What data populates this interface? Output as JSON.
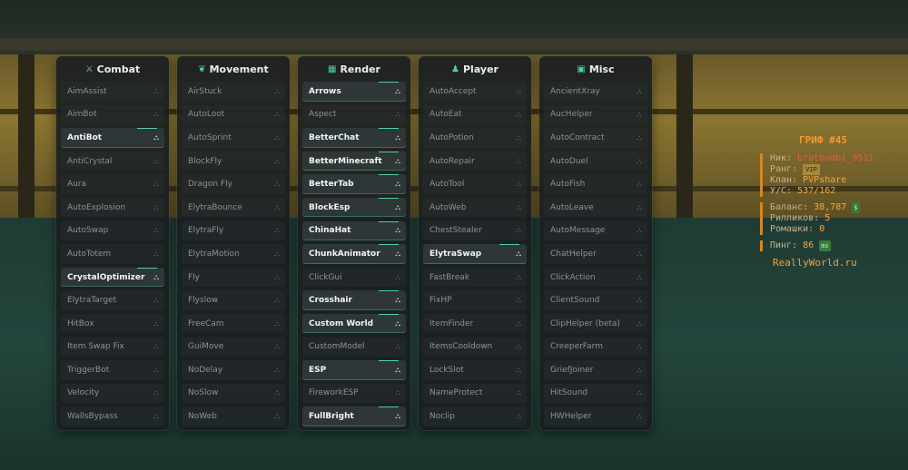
{
  "panels": [
    {
      "id": "combat",
      "icon": "crossed-swords-icon",
      "icon_char": "⚔",
      "title": "Combat",
      "modules": [
        {
          "label": "AimAssist",
          "on": false
        },
        {
          "label": "AimBot",
          "on": false
        },
        {
          "label": "AntiBot",
          "on": true
        },
        {
          "label": "AntiCrystal",
          "on": false
        },
        {
          "label": "Aura",
          "on": false
        },
        {
          "label": "AutoExplosion",
          "on": false
        },
        {
          "label": "AutoSwap",
          "on": false
        },
        {
          "label": "AutoTotem",
          "on": false
        },
        {
          "label": "CrystalOptimizer",
          "on": true
        },
        {
          "label": "ElytraTarget",
          "on": false
        },
        {
          "label": "HitBox",
          "on": false
        },
        {
          "label": "Item Swap Fix",
          "on": false
        },
        {
          "label": "TriggerBot",
          "on": false
        },
        {
          "label": "Velocity",
          "on": false
        },
        {
          "label": "WallsBypass",
          "on": false
        }
      ]
    },
    {
      "id": "movement",
      "icon": "leaf-icon",
      "icon_char": "❦",
      "title": "Movement",
      "modules": [
        {
          "label": "AirStuck",
          "on": false
        },
        {
          "label": "AutoLoot",
          "on": false
        },
        {
          "label": "AutoSprint",
          "on": false
        },
        {
          "label": "BlockFly",
          "on": false
        },
        {
          "label": "Dragon Fly",
          "on": false
        },
        {
          "label": "ElytraBounce",
          "on": false
        },
        {
          "label": "ElytraFly",
          "on": false
        },
        {
          "label": "ElytraMotion",
          "on": false
        },
        {
          "label": "Fly",
          "on": false
        },
        {
          "label": "Flyslow",
          "on": false
        },
        {
          "label": "FreeCam",
          "on": false
        },
        {
          "label": "GuiMove",
          "on": false
        },
        {
          "label": "NoDelay",
          "on": false
        },
        {
          "label": "NoSlow",
          "on": false
        },
        {
          "label": "NoWeb",
          "on": false
        }
      ]
    },
    {
      "id": "render",
      "icon": "grid-icon",
      "icon_char": "▦",
      "title": "Render",
      "modules": [
        {
          "label": "Arrows",
          "on": true
        },
        {
          "label": "Aspect",
          "on": false
        },
        {
          "label": "BetterChat",
          "on": true
        },
        {
          "label": "BetterMinecraft",
          "on": true
        },
        {
          "label": "BetterTab",
          "on": true
        },
        {
          "label": "BlockEsp",
          "on": true
        },
        {
          "label": "ChinaHat",
          "on": true
        },
        {
          "label": "ChunkAnimator",
          "on": true
        },
        {
          "label": "ClickGui",
          "on": false
        },
        {
          "label": "Crosshair",
          "on": true
        },
        {
          "label": "Custom World",
          "on": true
        },
        {
          "label": "CustomModel",
          "on": false
        },
        {
          "label": "ESP",
          "on": true
        },
        {
          "label": "FireworkESP",
          "on": false
        },
        {
          "label": "FullBright",
          "on": true
        }
      ]
    },
    {
      "id": "player",
      "icon": "person-icon",
      "icon_char": "♟",
      "title": "Player",
      "modules": [
        {
          "label": "AutoAccept",
          "on": false
        },
        {
          "label": "AutoEat",
          "on": false
        },
        {
          "label": "AutoPotion",
          "on": false
        },
        {
          "label": "AutoRepair",
          "on": false
        },
        {
          "label": "AutoTool",
          "on": false
        },
        {
          "label": "AutoWeb",
          "on": false
        },
        {
          "label": "ChestStealer",
          "on": false
        },
        {
          "label": "ElytraSwap",
          "on": true
        },
        {
          "label": "FastBreak",
          "on": false
        },
        {
          "label": "FixHP",
          "on": false
        },
        {
          "label": "ItemFinder",
          "on": false
        },
        {
          "label": "ItemsCooldown",
          "on": false
        },
        {
          "label": "LockSlot",
          "on": false
        },
        {
          "label": "NameProtect",
          "on": false
        },
        {
          "label": "Noclip",
          "on": false
        }
      ]
    },
    {
      "id": "misc",
      "icon": "box-icon",
      "icon_char": "▣",
      "title": "Misc",
      "modules": [
        {
          "label": "AncientXray",
          "on": false
        },
        {
          "label": "AucHelper",
          "on": false
        },
        {
          "label": "AutoContract",
          "on": false
        },
        {
          "label": "AutoDuel",
          "on": false
        },
        {
          "label": "AutoFish",
          "on": false
        },
        {
          "label": "AutoLeave",
          "on": false
        },
        {
          "label": "AutoMessage",
          "on": false
        },
        {
          "label": "ChatHelper",
          "on": false
        },
        {
          "label": "ClickAction",
          "on": false
        },
        {
          "label": "ClientSound",
          "on": false
        },
        {
          "label": "ClipHelper (beta)",
          "on": false
        },
        {
          "label": "CreeperFarm",
          "on": false
        },
        {
          "label": "GriefJoiner",
          "on": false
        },
        {
          "label": "HitSound",
          "on": false
        },
        {
          "label": "HWHelper",
          "on": false
        }
      ]
    }
  ],
  "gear_char": "⛬",
  "hud": {
    "title": "ГРИФ #45",
    "nick_label": "Ник:",
    "nick": "bratbombi_9511",
    "rank_label": "Ранг:",
    "rank_badge": "VIP",
    "clan_label": "Клан:",
    "clan": "PVPshare",
    "ks_label": "У/С:",
    "ks": "537/162",
    "balance_label": "Баланс:",
    "balance": "38,787",
    "balance_tag": "$",
    "rillik_label": "Рилликов:",
    "rillik": "5",
    "romashki_label": "Ромашки:",
    "romashki": "0",
    "ping_label": "Пинг:",
    "ping": "86",
    "ping_unit": "ms",
    "site": "ReallyWorld.ru",
    "side_numbers": [
      "1",
      "1",
      "1"
    ]
  }
}
